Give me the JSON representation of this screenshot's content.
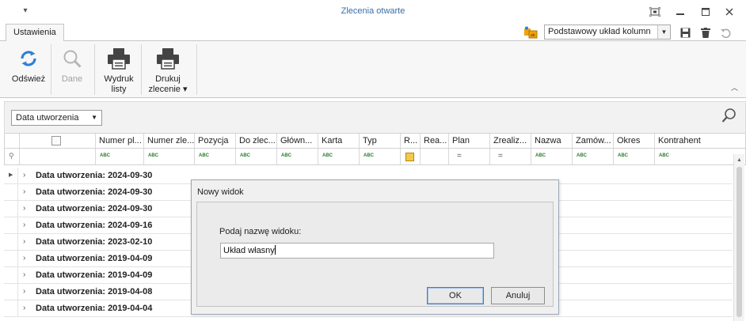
{
  "window": {
    "title": "Zlecenia otwarte",
    "quick_access_glyph": "▾"
  },
  "ribbon_tabs": {
    "active_tab": "Ustawienia"
  },
  "layout": {
    "selected": "Podstawowy układ kolumn"
  },
  "ribbon": {
    "buttons": [
      {
        "label": "Odśwież",
        "icon": "refresh-icon",
        "enabled": true
      },
      {
        "label": "Dane",
        "icon": "magnifier-icon",
        "enabled": false
      },
      {
        "label": "Wydruk\nlisty",
        "line1": "Wydruk",
        "line2": "listy",
        "icon": "printer-icon",
        "enabled": true
      },
      {
        "label": "Drukuj\nzlecenie ▾",
        "line1": "Drukuj",
        "line2": "zlecenie ▾",
        "icon": "printer-icon",
        "enabled": true
      }
    ]
  },
  "grouping": {
    "group_by": "Data utworzenia"
  },
  "grid": {
    "columns": [
      "Numer pl...",
      "Numer zle...",
      "Pozycja",
      "Do zlec...",
      "Główn...",
      "Karta",
      "Typ",
      "R...",
      "Rea...",
      "Plan",
      "Zrealiz...",
      "Nazwa",
      "Zamów...",
      "Okres",
      "Kontrahent"
    ],
    "filter_glyphs": {
      "text": "ABC",
      "numeric": "="
    },
    "groups": [
      "Data utworzenia: 2024-09-30",
      "Data utworzenia: 2024-09-30",
      "Data utworzenia: 2024-09-30",
      "Data utworzenia: 2024-09-16",
      "Data utworzenia: 2023-02-10",
      "Data utworzenia: 2019-04-09",
      "Data utworzenia: 2019-04-09",
      "Data utworzenia: 2019-04-08",
      "Data utworzenia: 2019-04-04"
    ]
  },
  "dialog": {
    "title": "Nowy widok",
    "prompt": "Podaj nazwę widoku:",
    "value": "Układ własny",
    "ok_label": "OK",
    "cancel_label": "Anuluj"
  },
  "colors": {
    "title_text": "#3a6ea5",
    "refresh_blue": "#2f7fd4",
    "accent_orange": "#f0a30a",
    "abc_green": "#2a7a2a"
  }
}
